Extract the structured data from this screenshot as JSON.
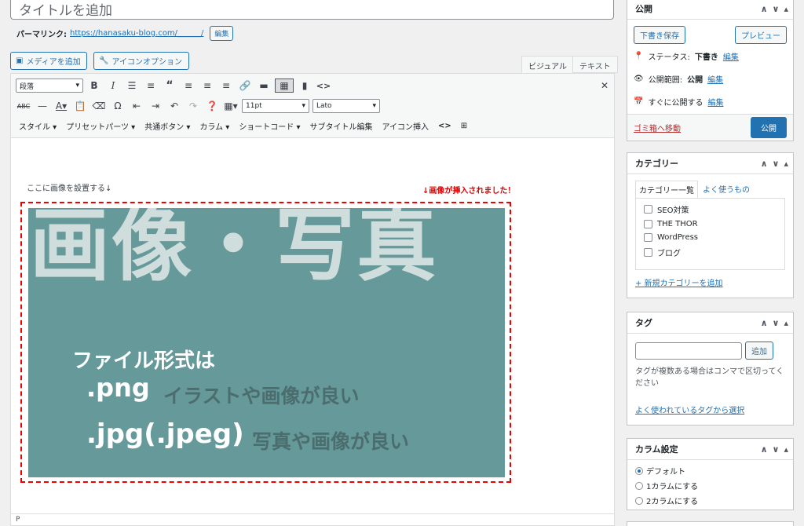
{
  "title": {
    "placeholder": "タイトルを追加"
  },
  "permalink": {
    "label": "パーマリンク:",
    "url": "https://hanasaku-blog.com/______/",
    "edit_label": "編集"
  },
  "media": {
    "add_media": "メディアを追加",
    "icon_option": "アイコンオプション"
  },
  "tabs": {
    "visual": "ビジュアル",
    "text": "テキスト"
  },
  "toolbar": {
    "paragraph_select": "段落",
    "fontsize_select": "11pt",
    "fontfamily_select": "Lato",
    "menu": [
      "スタイル ▾",
      "プリセットパーツ ▾",
      "共通ボタン ▾",
      "カラム ▾",
      "ショートコード ▾",
      "サブタイトル編集",
      "アイコン挿入"
    ]
  },
  "content": {
    "note": "ここに画像を設置する↓",
    "note_red": "↓画像が挿入されました！",
    "image": {
      "big_title": "画像・写真",
      "line1": "ファイル形式は",
      "png": ".png",
      "png_desc": "イラストや画像が良い",
      "jpg": ".jpg(.jpeg)",
      "jpg_desc": "写真や画像が良い"
    },
    "status_path": "P"
  },
  "publish": {
    "title": "公開",
    "save_draft": "下書き保存",
    "preview": "プレビュー",
    "status_label": "ステータス:",
    "status_value": "下書き",
    "visibility_label": "公開範囲:",
    "visibility_value": "公開",
    "schedule_label": "すぐに公開する",
    "edit": "編集",
    "trash": "ゴミ箱へ移動",
    "publish_button": "公開"
  },
  "categories": {
    "title": "カテゴリー",
    "tab_all": "カテゴリー一覧",
    "tab_popular": "よく使うもの",
    "items": [
      "SEO対策",
      "THE THOR",
      "WordPress",
      "ブログ"
    ],
    "add_new": "+ 新規カテゴリーを追加"
  },
  "tags": {
    "title": "タグ",
    "add_button": "追加",
    "help": "タグが複数ある場合はコンマで区切ってください",
    "choose_link": "よく使われているタグから選択"
  },
  "column": {
    "title": "カラム設定",
    "options": [
      "デフォルト",
      "1カラムにする",
      "2カラムにする"
    ],
    "selected_index": 0
  },
  "colors": {
    "accent": "#2271b1",
    "image_bg": "#66999a",
    "red": "#dd0000"
  }
}
